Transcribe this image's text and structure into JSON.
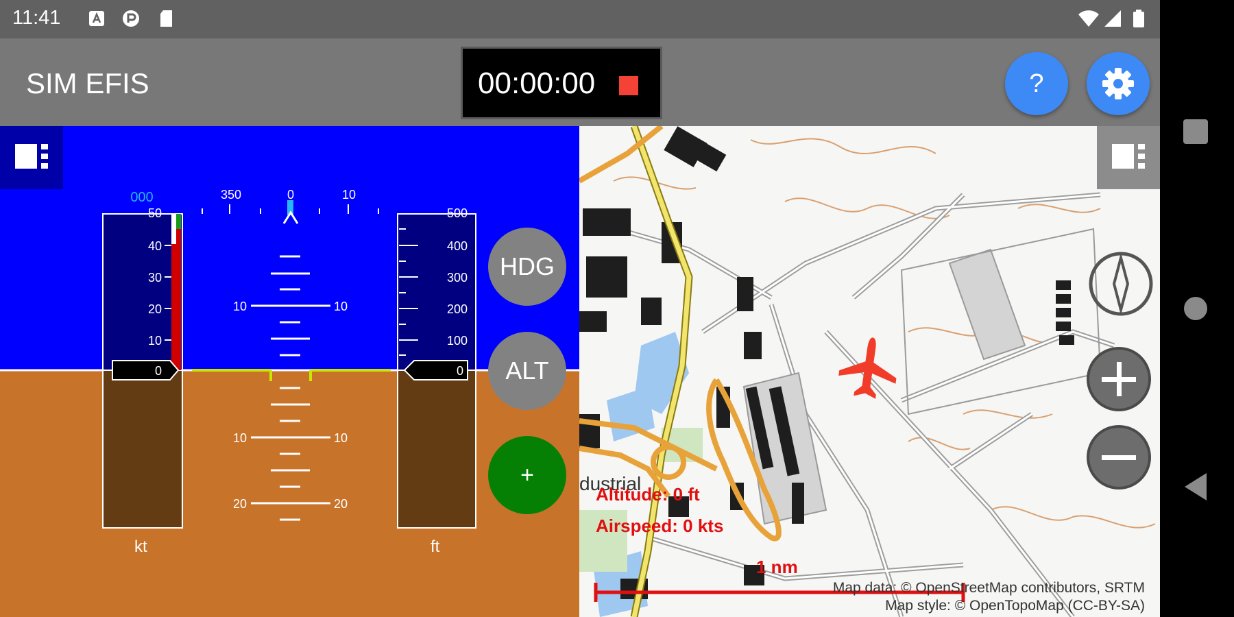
{
  "status_bar": {
    "time": "11:41",
    "left_icons": [
      "notification-a-icon",
      "sync-icon",
      "sd-card-icon"
    ],
    "right_icons": [
      "wifi-icon",
      "signal-icon",
      "battery-icon"
    ]
  },
  "app_bar": {
    "title": "SIM EFIS",
    "timer": "00:00:00",
    "help_label": "?",
    "settings_icon": "gear-icon"
  },
  "efis": {
    "heading_readout": "000",
    "heading_ticks": [
      "350",
      "0",
      "10"
    ],
    "speed_ticks": [
      "50",
      "40",
      "30",
      "20",
      "10"
    ],
    "speed_value": "0",
    "speed_unit": "kt",
    "altitude_ticks": [
      "500",
      "400",
      "300",
      "200",
      "100"
    ],
    "altitude_value": "0",
    "altitude_unit": "ft",
    "pitch_labels_up": [
      "10",
      "10"
    ],
    "pitch_labels_down_10": [
      "10",
      "10"
    ],
    "pitch_labels_down_20": [
      "20",
      "20"
    ],
    "hdg_button": "HDG",
    "alt_button": "ALT",
    "add_button": "+",
    "colors": {
      "sky": "#0000ff",
      "ground": "#c8732a",
      "tape": "#000080"
    }
  },
  "map": {
    "altitude_readout": "Altitude: 0 ft",
    "airspeed_readout": "Airspeed: 0 kts",
    "area_label": "dustrial",
    "scale_label": "1 nm",
    "attribution_line1": "Map data: © OpenStreetMap contributors, SRTM",
    "attribution_line2": "Map style: © OpenTopoMap (CC-BY-SA)",
    "aircraft_color": "#f03c28"
  }
}
